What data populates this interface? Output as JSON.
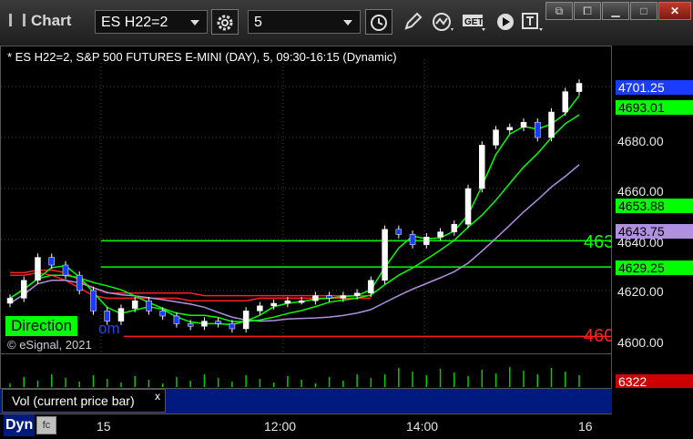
{
  "window": {
    "title": "Chart"
  },
  "toolbar": {
    "symbol": "ES H22=2",
    "interval": "5"
  },
  "chart": {
    "caption": "* ES H22=2, S&P 500 FUTURES E-MINI (DAY), 5, 09:30-16:15 (Dynamic)",
    "copyright": "© eSignal, 2021",
    "direction_label": "Direction",
    "direction_tail": "om",
    "green_level_label": "463",
    "red_level_label": "460",
    "colors": {
      "green": "#00ff00",
      "red": "#ff2020",
      "purple": "#b090e0",
      "candle_up": "#ffffff",
      "candle_down": "#1a3cff",
      "volume": "#00cc00"
    }
  },
  "price_axis": {
    "ticks": [
      "4680.00",
      "4660.00",
      "4640.00",
      "4620.00",
      "4600.00"
    ],
    "last_price": "4701.25",
    "ma_fast": "4693.01",
    "ma_mid": "4653.88",
    "ma_slow": "4643.75",
    "level_green": "4629.25"
  },
  "time_axis": {
    "labels": [
      "15",
      "12:00",
      "14:00",
      "16"
    ]
  },
  "volume": {
    "panel_label": "Vol (current price bar)",
    "close_glyph": "x",
    "value": "6322"
  },
  "status": {
    "dyn_label": "Dyn",
    "dyn_icon": "fc"
  },
  "chart_data": {
    "type": "line",
    "series": [
      {
        "values": [
          4617,
          4624,
          4633,
          4630,
          4626,
          4620,
          4612,
          4608,
          4613,
          4616,
          4612,
          4610,
          4607,
          4606,
          4608,
          4607,
          4605,
          4612,
          4614,
          4615,
          4616,
          4616,
          4618,
          4617,
          4618,
          4619,
          4624,
          4644,
          4642,
          4638,
          4641,
          4643,
          4646,
          4660,
          4677,
          4683,
          4684,
          4686,
          4680,
          4690,
          4698,
          4701.25
        ]
      }
    ],
    "levels": [
      {
        "price": 4639.5,
        "color": "green"
      },
      {
        "price": 4629.25,
        "color": "green"
      },
      {
        "price": 4602,
        "color": "red"
      }
    ],
    "ylim": [
      4600,
      4705
    ]
  }
}
